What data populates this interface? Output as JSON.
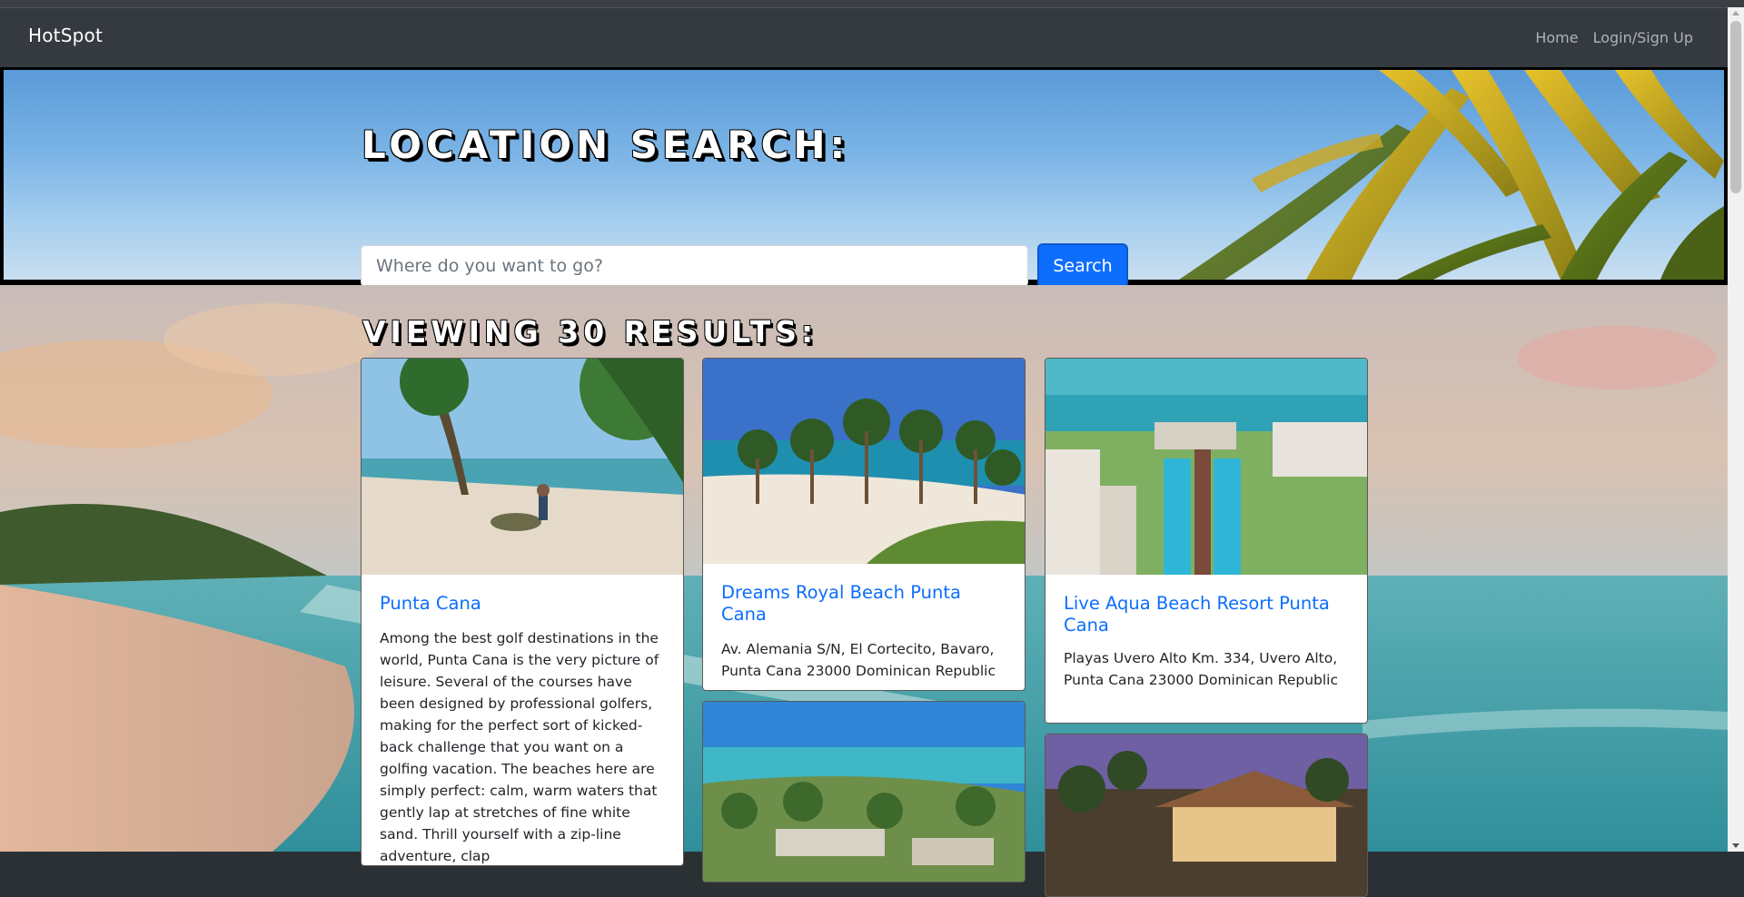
{
  "nav": {
    "brand": "HotSpot",
    "links": [
      {
        "label": "Home"
      },
      {
        "label": "Login/Sign Up"
      }
    ]
  },
  "hero": {
    "title": "Location Search:",
    "search_placeholder": "Where do you want to go?",
    "search_button": "Search"
  },
  "results": {
    "title": "Viewing 30 Results:",
    "cards": [
      {
        "title": "Punta Cana",
        "text": "Among the best golf destinations in the world, Punta Cana is the very picture of leisure. Several of the courses have been designed by professional golfers, making for the perfect sort of kicked-back challenge that you want on a golfing vacation. The beaches here are simply perfect: calm, warm waters that gently lap at stretches of fine white sand. Thrill yourself with a zip-line adventure, clap"
      },
      {
        "title": "Dreams Royal Beach Punta Cana",
        "text": "Av. Alemania S/N, El Cortecito, Bavaro, Punta Cana 23000 Dominican Republic"
      },
      {
        "title": "Live Aqua Beach Resort Punta Cana",
        "text": "Playas Uvero Alto Km. 334, Uvero Alto, Punta Cana 23000 Dominican Republic"
      }
    ]
  }
}
